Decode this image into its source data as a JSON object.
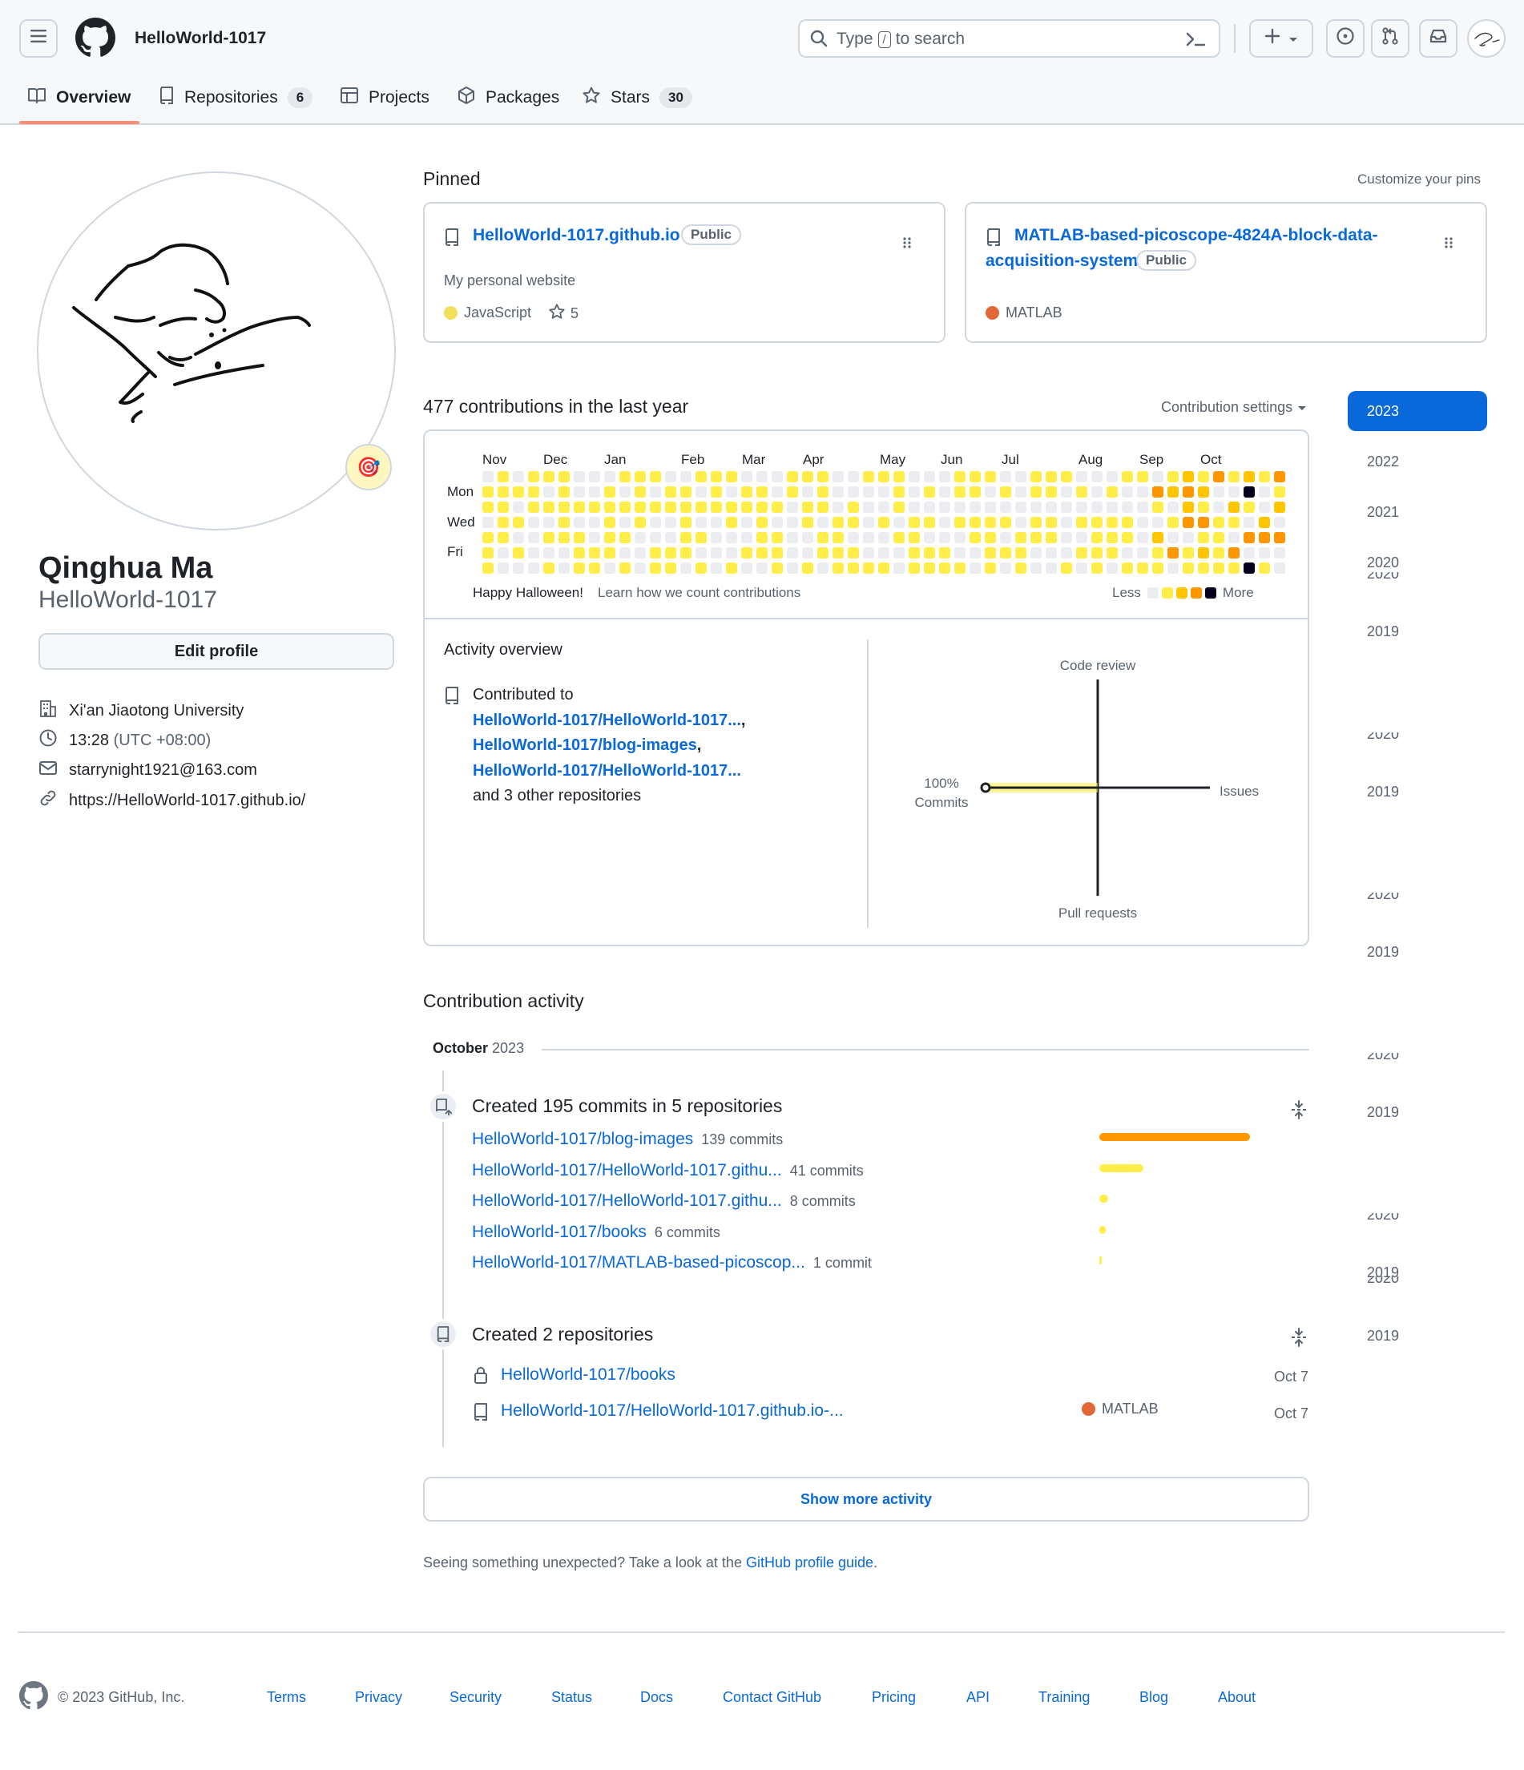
{
  "header": {
    "username": "HelloWorld-1017",
    "search_placeholder_pre": "Type",
    "search_key": "/",
    "search_placeholder_post": "to search",
    "tabs": [
      {
        "label": "Overview",
        "count": ""
      },
      {
        "label": "Repositories",
        "count": "6"
      },
      {
        "label": "Projects",
        "count": ""
      },
      {
        "label": "Packages",
        "count": ""
      },
      {
        "label": "Stars",
        "count": "30"
      }
    ]
  },
  "profile": {
    "name": "Qinghua Ma",
    "login": "HelloWorld-1017",
    "edit_button": "Edit profile",
    "organization": "Xi'an Jiaotong University",
    "time": "13:28",
    "timezone": "(UTC +08:00)",
    "email": "starrynight1921@163.com",
    "website": "https://HelloWorld-1017.github.io/",
    "status_emoji": "🎯"
  },
  "pinned": {
    "title": "Pinned",
    "customize": "Customize your pins",
    "cards": [
      {
        "name": "HelloWorld-1017.github.io",
        "badge": "Public",
        "description": "My personal website",
        "language": "JavaScript",
        "language_color": "#f1e05a",
        "stars": "5"
      },
      {
        "name_line1": "MATLAB-based-picoscope-4824A-block-data-",
        "name_line2": "acquisition-system",
        "badge": "Public",
        "language": "MATLAB",
        "language_color": "#e16737"
      }
    ]
  },
  "contributions": {
    "heading": "477 contributions in the last year",
    "settings": "Contribution settings",
    "months": [
      "Nov",
      "Dec",
      "Jan",
      "Feb",
      "Mar",
      "Apr",
      "May",
      "Jun",
      "Jul",
      "Aug",
      "Sep",
      "Oct"
    ],
    "days": [
      "Mon",
      "Wed",
      "Fri"
    ],
    "footer_left": "Happy Halloween!",
    "footer_link": "Learn how we count contributions",
    "less": "Less",
    "more": "More",
    "level_colors": [
      "#ebedf0",
      "#ffee4a",
      "#ffc501",
      "#fe9600",
      "#03001c"
    ]
  },
  "years": [
    "2023",
    "2022",
    "2021",
    "2020",
    "2020",
    "2019",
    "2020",
    "2019",
    "2020",
    "2019",
    "2020",
    "2019",
    "2020",
    "2019",
    "2020",
    "2019"
  ],
  "activity_overview": {
    "title": "Activity overview",
    "contributed_to": "Contributed to",
    "repos": [
      "HelloWorld-1017/HelloWorld-1017...",
      "HelloWorld-1017/blog-images",
      "HelloWorld-1017/HelloWorld-1017..."
    ],
    "others": "and 3 other repositories",
    "axes": {
      "top": "Code review",
      "bottom": "Pull requests",
      "left_pct": "100%",
      "left": "Commits",
      "right": "Issues"
    },
    "commits_fraction": 1.0
  },
  "contribution_activity": {
    "title": "Contribution activity",
    "month": "October",
    "year": "2023",
    "commits_heading": "Created 195 commits in 5 repositories",
    "commit_repos": [
      {
        "name": "HelloWorld-1017/blog-images",
        "count": "139 commits",
        "value": 139
      },
      {
        "name": "HelloWorld-1017/HelloWorld-1017.githu...",
        "count": "41 commits",
        "value": 41
      },
      {
        "name": "HelloWorld-1017/HelloWorld-1017.githu...",
        "count": "8 commits",
        "value": 8
      },
      {
        "name": "HelloWorld-1017/books",
        "count": "6 commits",
        "value": 6
      },
      {
        "name": "HelloWorld-1017/MATLAB-based-picoscop...",
        "count": "1 commit",
        "value": 1
      }
    ],
    "repos_heading": "Created 2 repositories",
    "created_repos": [
      {
        "name": "HelloWorld-1017/books",
        "language": "",
        "date": "Oct 7"
      },
      {
        "name": "HelloWorld-1017/HelloWorld-1017.github.io-...",
        "language": "MATLAB",
        "date": "Oct 7"
      }
    ],
    "show_more": "Show more activity",
    "unexpected": "Seeing something unexpected? Take a look at the",
    "guide_link": "GitHub profile guide",
    "period": "."
  },
  "footer": {
    "copyright": "© 2023 GitHub, Inc.",
    "links": [
      "Terms",
      "Privacy",
      "Security",
      "Status",
      "Docs",
      "Contact GitHub",
      "Pricing",
      "API",
      "Training",
      "Blog",
      "About"
    ]
  }
}
